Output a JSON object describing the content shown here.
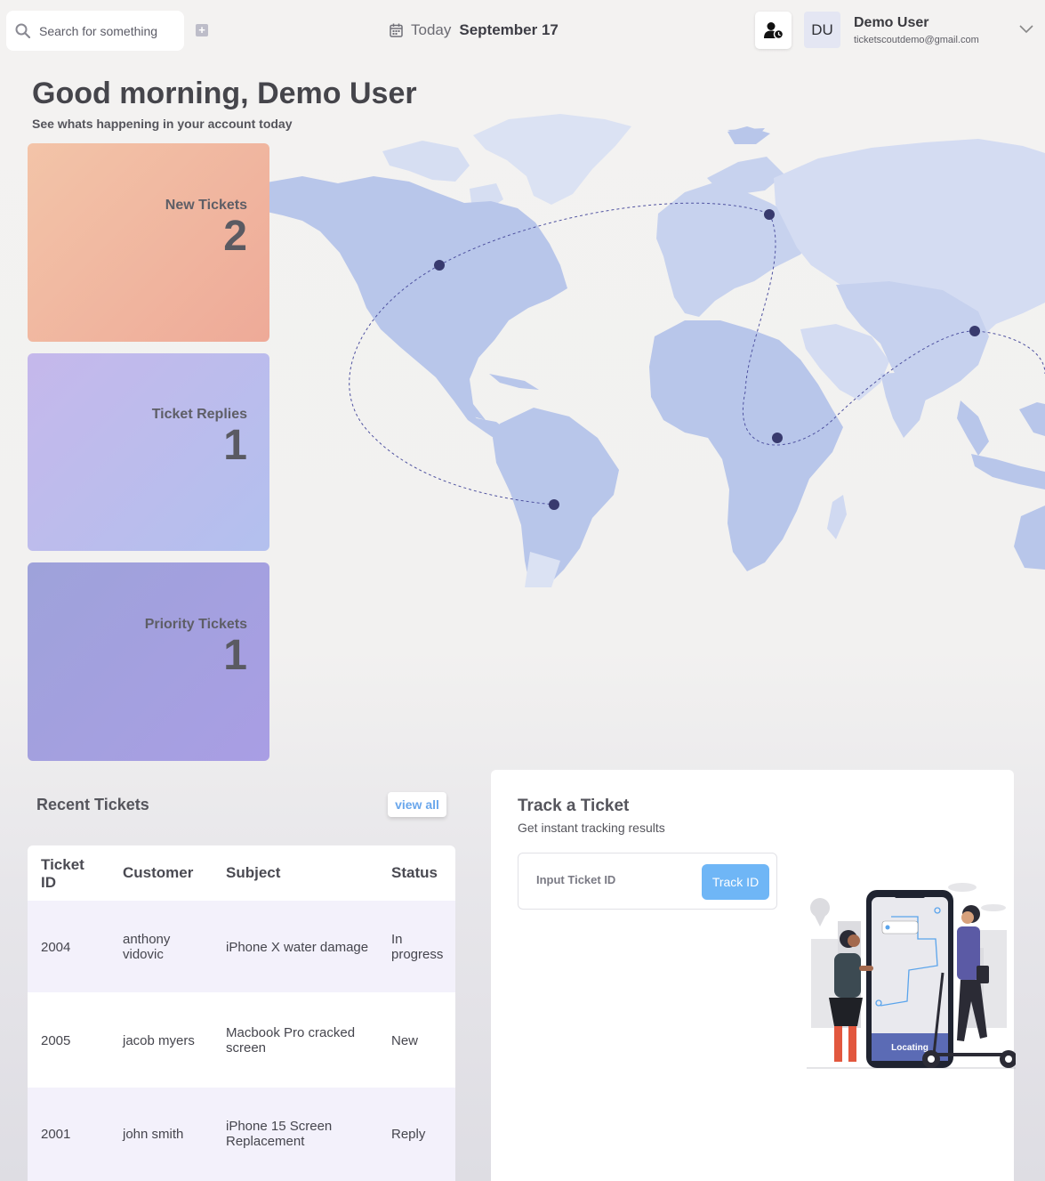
{
  "search": {
    "placeholder": "Search for something"
  },
  "date": {
    "prefix": "Today",
    "value": "September 17"
  },
  "user": {
    "initials": "DU",
    "name": "Demo User",
    "email": "ticketscoutdemo@gmail.com"
  },
  "greeting": {
    "title": "Good morning, Demo User",
    "subtitle": "See whats happening in your account today"
  },
  "cards": {
    "new": {
      "label": "New Tickets",
      "value": "2"
    },
    "replies": {
      "label": "Ticket Replies",
      "value": "1"
    },
    "priority": {
      "label": "Priority Tickets",
      "value": "1"
    }
  },
  "recent": {
    "title": "Recent Tickets",
    "view_all": "view all",
    "columns": {
      "id": "Ticket ID",
      "customer": "Customer",
      "subject": "Subject",
      "status": "Status"
    },
    "rows": [
      {
        "id": "2004",
        "customer": "anthony vidovic",
        "subject": "iPhone X water damage",
        "status": "In progress"
      },
      {
        "id": "2005",
        "customer": "jacob myers",
        "subject": "Macbook Pro cracked screen",
        "status": "New"
      },
      {
        "id": "2001",
        "customer": "john smith",
        "subject": "iPhone 15 Screen Replacement",
        "status": "Reply"
      }
    ]
  },
  "track": {
    "title": "Track a Ticket",
    "subtitle": "Get instant tracking results",
    "input_placeholder": "Input Ticket ID",
    "button": "Track ID",
    "phone_status": "Locating"
  },
  "colors": {
    "accent": "#6fb6f6",
    "map_land": "#b8c6ea",
    "map_land_light": "#d8e0f3",
    "map_dot": "#383a6e"
  },
  "icons": {
    "search": "search-icon",
    "add": "plus-square-icon",
    "calendar": "calendar-icon",
    "user_clock": "user-clock-icon",
    "chevron": "chevron-down-icon"
  }
}
